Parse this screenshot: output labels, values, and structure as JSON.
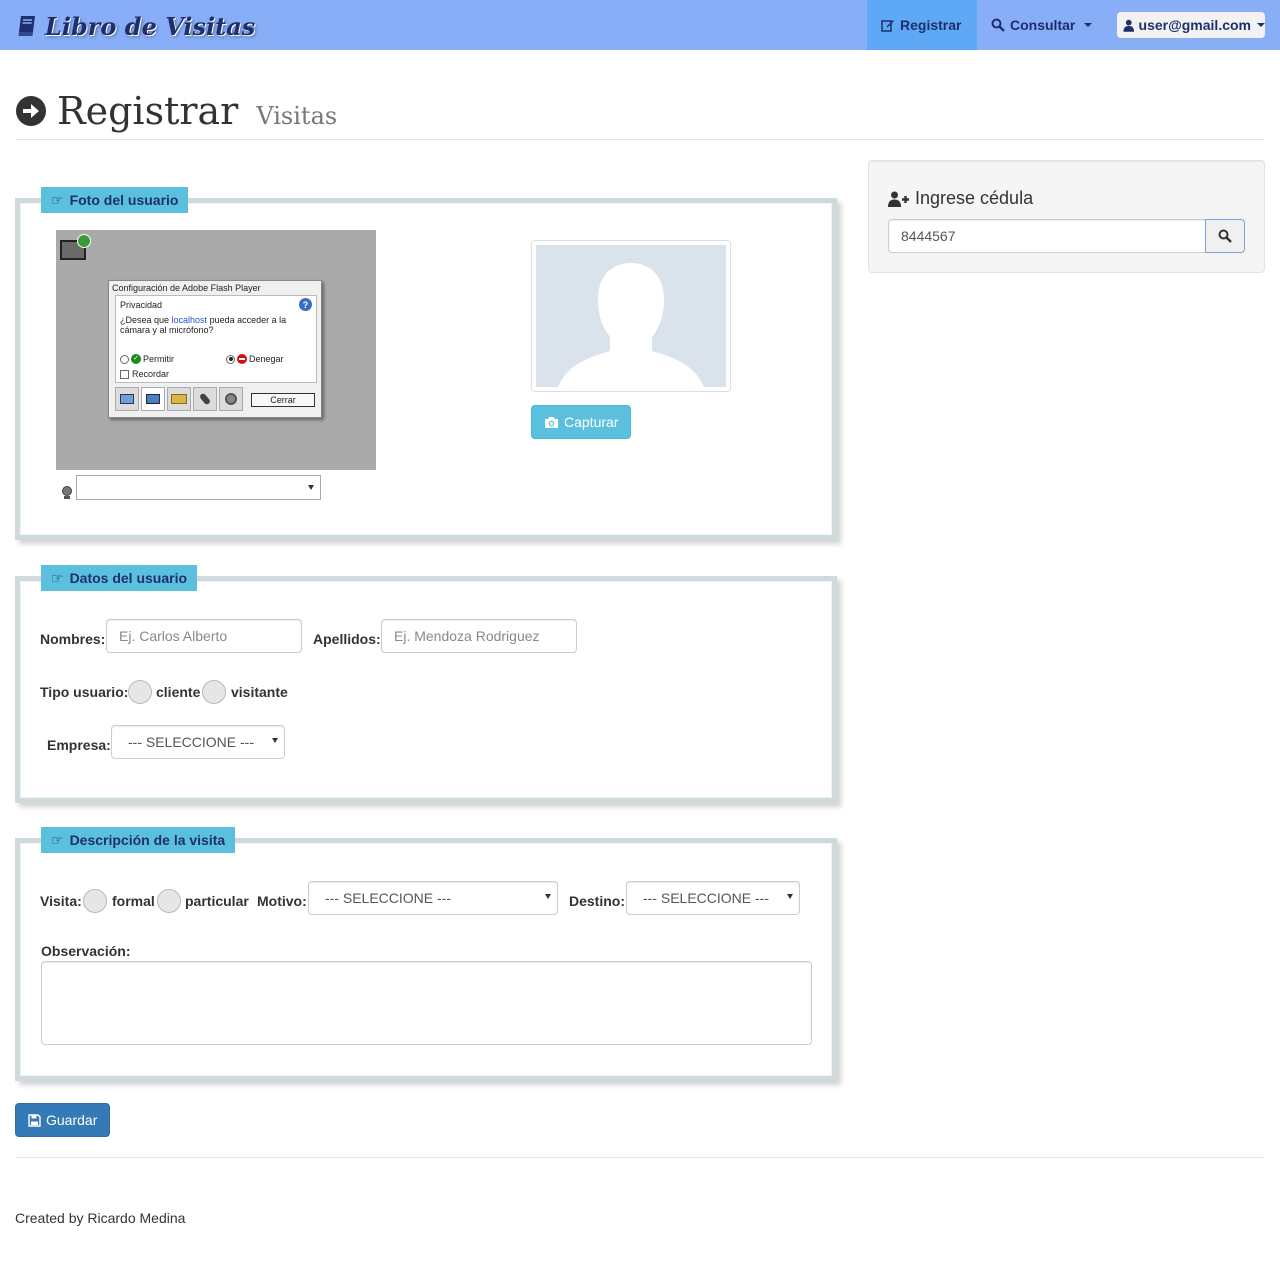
{
  "navbar": {
    "brand": "Libro de Visitas",
    "register": "Registrar",
    "consult": "Consultar",
    "user": "user@gmail.com"
  },
  "header": {
    "title": "Registrar",
    "subtitle": "Visitas"
  },
  "photo_section": {
    "legend": "Foto del usuario",
    "flash": {
      "title": "Configuración de Adobe Flash Player",
      "section": "Privacidad",
      "question_pre": "¿Desea que ",
      "question_link": "localhost",
      "question_post": " pueda acceder a la cámara y al micrófono?",
      "allow": "Permitir",
      "deny": "Denegar",
      "remember": "Recordar",
      "close": "Cerrar"
    },
    "capture_button": "Capturar"
  },
  "user_section": {
    "legend": "Datos del usuario",
    "names_label": "Nombres:",
    "names_placeholder": "Ej. Carlos Alberto",
    "surnames_label": "Apellidos:",
    "surnames_placeholder": "Ej. Mendoza Rodriguez",
    "type_label": "Tipo usuario:",
    "type_client": "cliente",
    "type_visitor": "visitante",
    "company_label": "Empresa:",
    "company_value": "--- SELECCIONE ---"
  },
  "visit_section": {
    "legend": "Descripción de la visita",
    "visit_label": "Visita:",
    "visit_formal": "formal",
    "visit_particular": "particular",
    "reason_label": "Motivo:",
    "reason_value": "--- SELECCIONE ---",
    "destination_label": "Destino:",
    "destination_value": "--- SELECCIONE ---",
    "observation_label": "Observación:"
  },
  "save_button": "Guardar",
  "id_panel": {
    "title": "Ingrese cédula",
    "value": "8444567"
  },
  "footer": "Created by Ricardo Medina",
  "colors": {
    "navbar": "#89aef8",
    "nav_active": "#5fa8f5",
    "legend": "#5bc0de",
    "primary": "#337ab7"
  }
}
